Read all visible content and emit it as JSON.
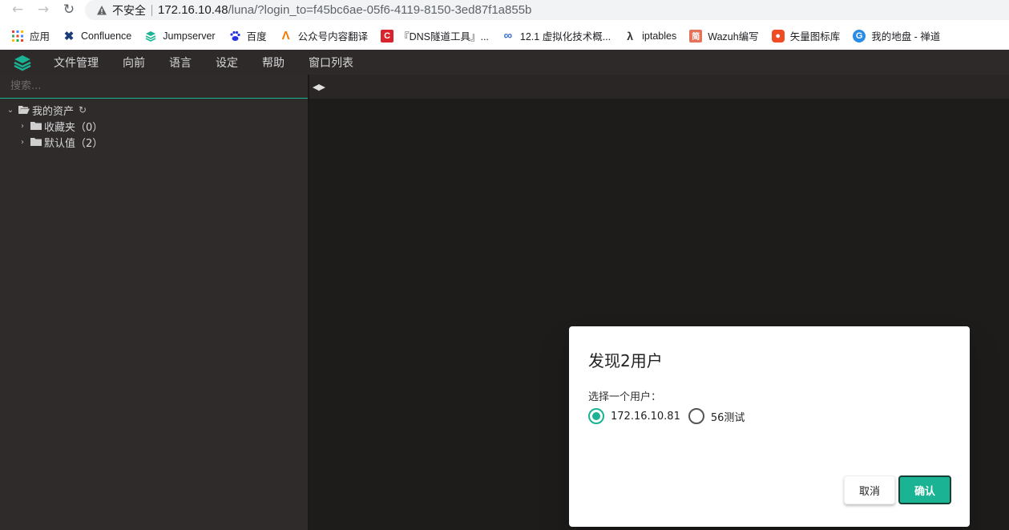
{
  "browser": {
    "security_label": "不安全",
    "url_host": "172.16.10.48",
    "url_path": "/luna/?login_to=f45bc6ae-05f6-4119-8150-3ed87f1a855b"
  },
  "bookmarks": [
    {
      "label": "应用",
      "icon": "apps-grid-icon"
    },
    {
      "label": "Confluence",
      "icon": "confluence-icon"
    },
    {
      "label": "Jumpserver",
      "icon": "jumpserver-icon"
    },
    {
      "label": "百度",
      "icon": "baidu-paw-icon"
    },
    {
      "label": "公众号内容翻译",
      "icon": "lambda-icon"
    },
    {
      "label": "『DNS隧道工具』...",
      "icon": "c-badge-icon"
    },
    {
      "label": "12.1 虚拟化技术概...",
      "icon": "infinity-icon"
    },
    {
      "label": "iptables",
      "icon": "script-icon"
    },
    {
      "label": "Wazuh编写",
      "icon": "jian-icon"
    },
    {
      "label": "矢量图标库",
      "icon": "iconfont-icon"
    },
    {
      "label": "我的地盘 - 禅道",
      "icon": "zentao-icon"
    }
  ],
  "menu": {
    "items": [
      "文件管理",
      "向前",
      "语言",
      "设定",
      "帮助",
      "窗口列表"
    ]
  },
  "sidebar": {
    "search_placeholder": "搜索...",
    "root_label": "我的资产",
    "children": [
      {
        "label": "收藏夹（0）"
      },
      {
        "label": "默认值（2）"
      }
    ]
  },
  "dialog": {
    "title": "发现2用户",
    "subtitle": "选择一个用户：",
    "options": [
      {
        "label": "172.16.10.81",
        "checked": true
      },
      {
        "label": "56测试",
        "checked": false
      }
    ],
    "cancel_label": "取消",
    "confirm_label": "确认"
  },
  "colors": {
    "accent": "#1ab394"
  }
}
